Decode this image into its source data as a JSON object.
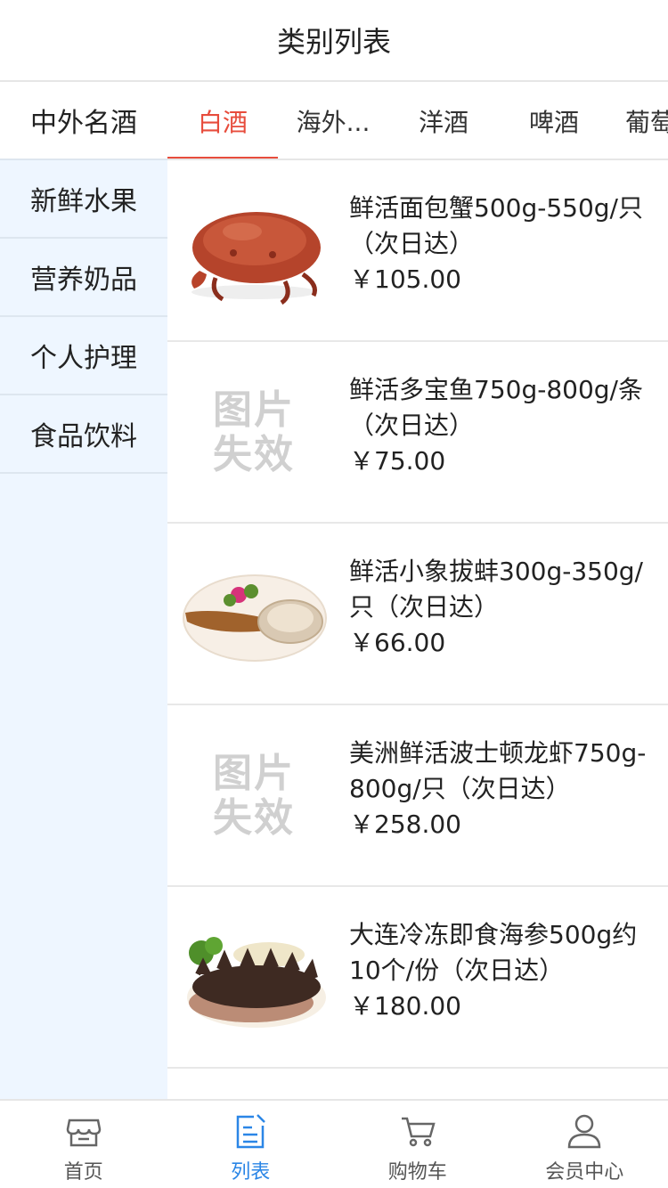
{
  "header": {
    "title": "类别列表"
  },
  "sidebar": {
    "items": [
      {
        "label": "中外名酒"
      },
      {
        "label": "新鲜水果"
      },
      {
        "label": "营养奶品"
      },
      {
        "label": "个人护理"
      },
      {
        "label": "食品饮料"
      }
    ]
  },
  "tabs": [
    {
      "label": "白酒"
    },
    {
      "label": "海外..."
    },
    {
      "label": "洋酒"
    },
    {
      "label": "啤酒"
    },
    {
      "label": "葡萄"
    }
  ],
  "products": [
    {
      "name": "鲜活面包蟹500g-550g/只（次日达）",
      "price": "￥105.00",
      "image": "crab"
    },
    {
      "name": "鲜活多宝鱼750g-800g/条（次日达）",
      "price": "￥75.00",
      "image_text": "图片失效"
    },
    {
      "name": "鲜活小象拔蚌300g-350g/只（次日达）",
      "price": "￥66.00",
      "image": "geoduck"
    },
    {
      "name": "美洲鲜活波士顿龙虾750g-800g/只（次日达）",
      "price": "￥258.00",
      "image_text": "图片失效"
    },
    {
      "name": "大连冷冻即食海参500g约10个/份（次日达）",
      "price": "￥180.00",
      "image": "sea-cucumber"
    }
  ],
  "bottom_nav": [
    {
      "label": "首页",
      "icon": "store-icon"
    },
    {
      "label": "列表",
      "icon": "list-icon"
    },
    {
      "label": "购物车",
      "icon": "cart-icon"
    },
    {
      "label": "会员中心",
      "icon": "user-icon"
    }
  ],
  "colors": {
    "accent_red": "#e74c3c",
    "accent_blue": "#2b86e6",
    "sidebar_bg": "#eef6ff"
  }
}
